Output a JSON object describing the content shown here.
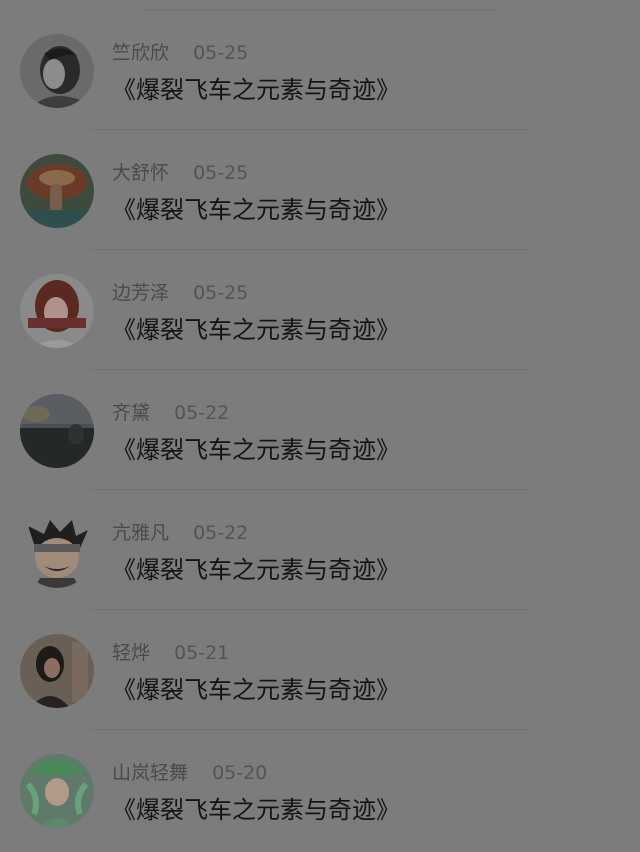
{
  "comments": [
    {
      "name": "竺欣欣",
      "date": "05-25",
      "text": "《爆裂飞车之元素与奇迹》",
      "avatar_icon": "man-portrait-avatar"
    },
    {
      "name": "大舒怀",
      "date": "05-25",
      "text": "《爆裂飞车之元素与奇迹》",
      "avatar_icon": "mushroom-finger-avatar"
    },
    {
      "name": "边芳泽",
      "date": "05-25",
      "text": "《爆裂飞车之元素与奇迹》",
      "avatar_icon": "girl-red-hair-avatar"
    },
    {
      "name": "齐黛",
      "date": "05-22",
      "text": "《爆裂飞车之元素与奇迹》",
      "avatar_icon": "sunset-landscape-avatar"
    },
    {
      "name": "亢雅凡",
      "date": "05-22",
      "text": "《爆裂飞车之元素与奇迹》",
      "avatar_icon": "anime-ninja-avatar"
    },
    {
      "name": "轻烨",
      "date": "05-21",
      "text": "《爆裂飞车之元素与奇迹》",
      "avatar_icon": "woman-photo-avatar"
    },
    {
      "name": "山岚轻舞",
      "date": "05-20",
      "text": "《爆裂飞车之元素与奇迹》",
      "avatar_icon": "green-fairy-avatar"
    }
  ]
}
